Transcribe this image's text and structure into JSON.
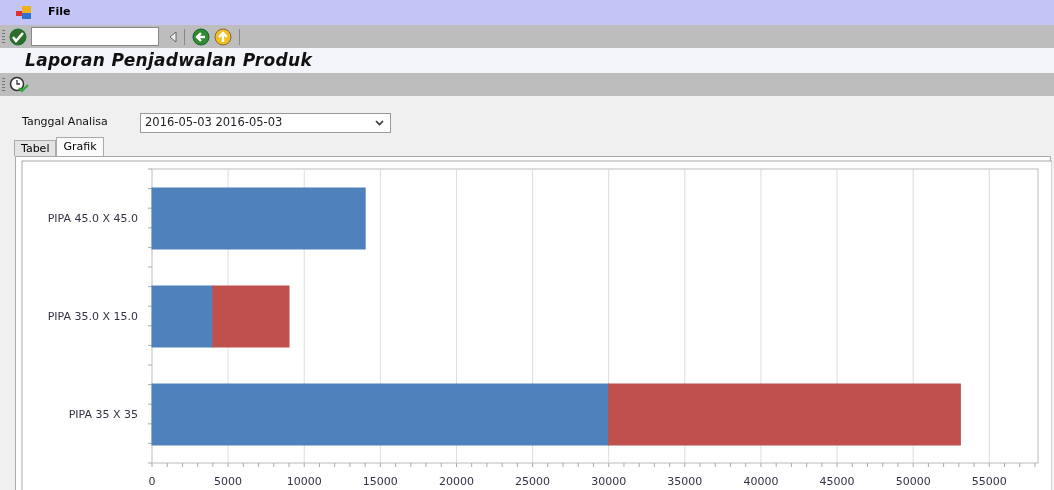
{
  "menu": [
    {
      "label": "File"
    }
  ],
  "title": "Laporan Penjadwalan Produk",
  "filter": {
    "label": "Tanggal Analisa",
    "value": "2016-05-03 2016-05-03"
  },
  "tabs": [
    {
      "label": "Tabel",
      "selected": false
    },
    {
      "label": "Grafik",
      "selected": true
    }
  ],
  "chart_data": {
    "type": "bar",
    "orientation": "horizontal",
    "stacked": true,
    "grid": true,
    "categories": [
      "PIPA 45.0 X 45.0",
      "PIPA 35.0 X 15.0",
      "PIPA 35 X 35"
    ],
    "series": [
      {
        "color": "#4f81bd",
        "values": [
          14000,
          4000,
          30000
        ]
      },
      {
        "color": "#c0504d",
        "values": [
          0,
          5000,
          23100
        ]
      }
    ],
    "xlim": [
      0,
      58200
    ],
    "xticks": [
      0,
      5000,
      10000,
      15000,
      20000,
      25000,
      30000,
      35000,
      40000,
      45000,
      50000,
      55000
    ]
  }
}
